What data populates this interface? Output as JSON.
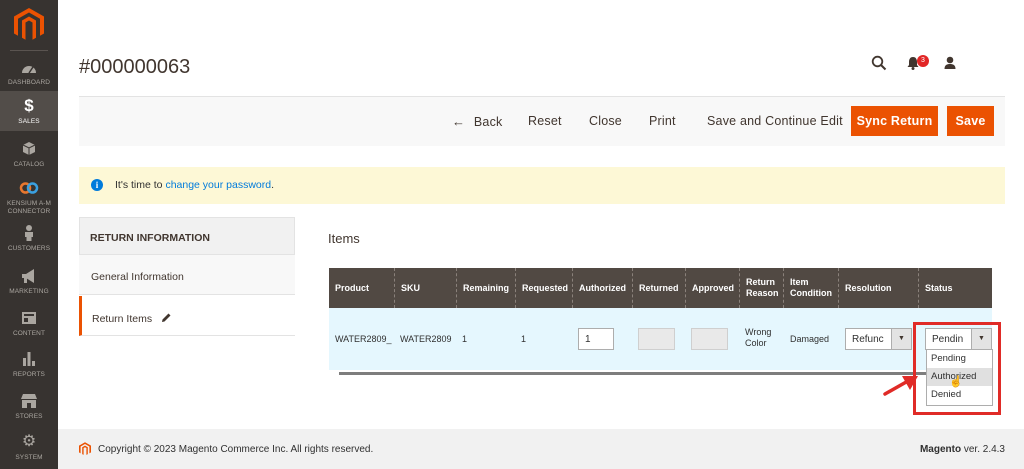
{
  "sidebar": {
    "items": [
      {
        "label": "Dashboard",
        "icon": "dashboard-icon"
      },
      {
        "label": "Sales",
        "icon": "dollar-icon",
        "glyph": "$",
        "active": true
      },
      {
        "label": "Catalog",
        "icon": "cube-icon"
      },
      {
        "label": "Kensium A-M",
        "label2": "Connector",
        "icon": "connector-icon"
      },
      {
        "label": "Customers",
        "icon": "person-icon"
      },
      {
        "label": "Marketing",
        "icon": "megaphone-icon"
      },
      {
        "label": "Content",
        "icon": "content-icon"
      },
      {
        "label": "Reports",
        "icon": "bar-chart-icon"
      },
      {
        "label": "Stores",
        "icon": "store-icon"
      },
      {
        "label": "System",
        "icon": "gear-icon"
      }
    ]
  },
  "header": {
    "title": "#000000063",
    "notifications_count": "3"
  },
  "actions": {
    "back": "Back",
    "reset": "Reset",
    "close": "Close",
    "print": "Print",
    "save_continue": "Save and Continue Edit",
    "sync": "Sync Return",
    "save": "Save"
  },
  "message": {
    "text_before": "It's time to ",
    "link": "change your password",
    "text_after": "."
  },
  "tabs": {
    "heading": "RETURN INFORMATION",
    "items": [
      "General Information",
      "Return Items"
    ]
  },
  "items_section": {
    "title": "Items",
    "columns": [
      "Product",
      "SKU",
      "Remaining",
      "Requested",
      "Authorized",
      "Returned",
      "Approved",
      "Return Reason",
      "Item Condition",
      "Resolution",
      "Status"
    ],
    "row": {
      "product": "WATER2809_",
      "sku": "WATER2809",
      "remaining": "1",
      "requested": "1",
      "authorized": "1",
      "returned": "",
      "approved": "",
      "reason_line1": "Wrong",
      "reason_line2": "Color",
      "condition": "Damaged",
      "resolution": "Refunc",
      "status": "Pendin"
    },
    "status_options": [
      "Pending",
      "Authorized",
      "Denied"
    ],
    "status_hovered": "Authorized"
  },
  "footer": {
    "copyright": "Copyright © 2023 Magento Commerce Inc. All rights reserved.",
    "brand": "Magento",
    "version": " ver. 2.4.3"
  },
  "colors": {
    "accent": "#eb5202",
    "sidebar": "#373330",
    "grid_header": "#514943",
    "row_bg": "#e5f7fe",
    "highlight": "#e02b27"
  }
}
